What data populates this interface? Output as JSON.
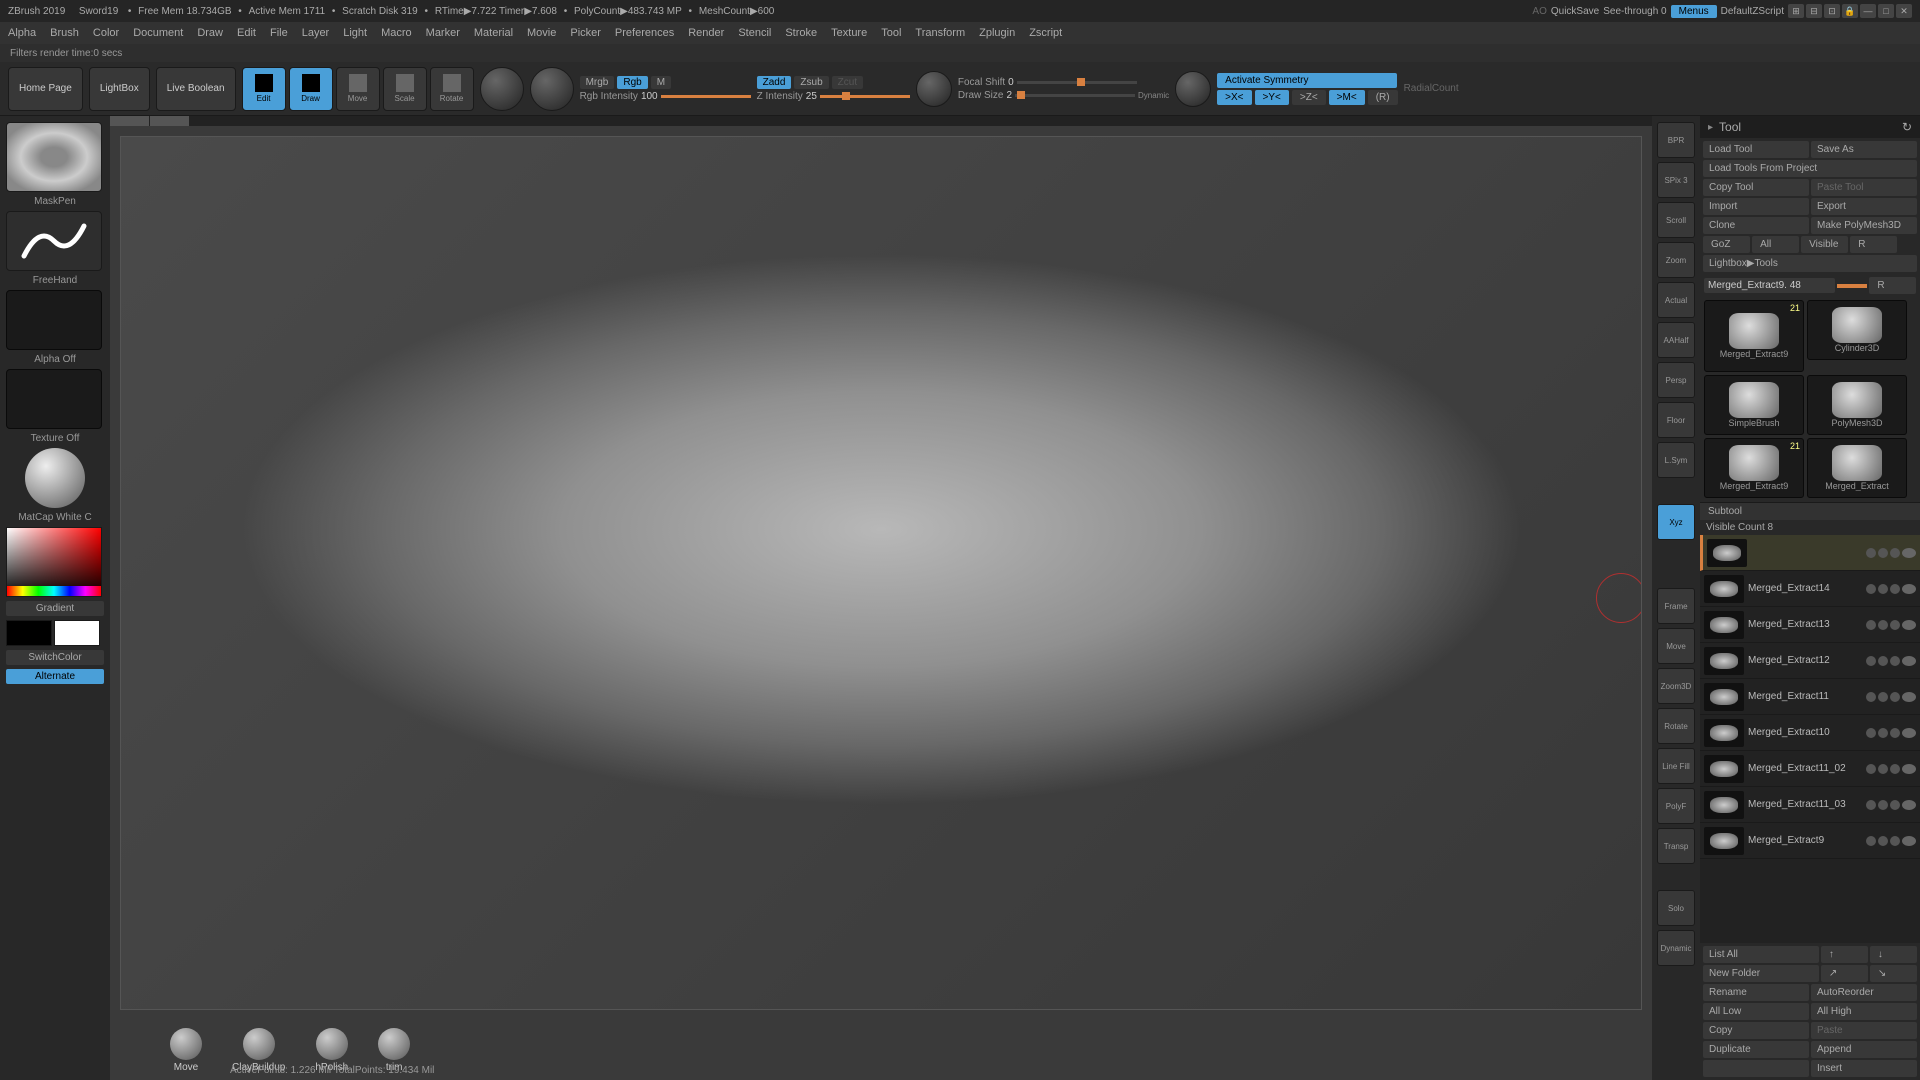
{
  "titlebar": {
    "app": "ZBrush 2019",
    "file": "Sword19",
    "stats": [
      "Free Mem 18.734GB",
      "Active Mem 1711",
      "Scratch Disk 319",
      "RTime▶7.722 Timer▶7.608",
      "PolyCount▶483.743 MP",
      "MeshCount▶600"
    ],
    "ao": "AO",
    "quicksave": "QuickSave",
    "seethrough": "See-through  0",
    "menus": "Menus",
    "script": "DefaultZScript"
  },
  "menus": [
    "Alpha",
    "Brush",
    "Color",
    "Document",
    "Draw",
    "Edit",
    "File",
    "Layer",
    "Light",
    "Macro",
    "Marker",
    "Material",
    "Movie",
    "Picker",
    "Preferences",
    "Render",
    "Stencil",
    "Stroke",
    "Texture",
    "Tool",
    "Transform",
    "Zplugin",
    "Zscript"
  ],
  "status": "Filters render time:0 secs",
  "toolbar": {
    "home": "Home Page",
    "lightbox": "LightBox",
    "liveboolean": "Live Boolean",
    "modes": [
      "Edit",
      "Draw",
      "Move",
      "Scale",
      "Rotate"
    ],
    "mrgb": "Mrgb",
    "rgb": "Rgb",
    "m": "M",
    "rgbint_lbl": "Rgb Intensity",
    "rgbint_val": "100",
    "zadd": "Zadd",
    "zsub": "Zsub",
    "zcut": "Zcut",
    "zint_lbl": "Z Intensity",
    "zint_val": "25",
    "focal_lbl": "Focal Shift",
    "focal_val": "0",
    "draw_lbl": "Draw Size",
    "draw_val": "2",
    "dynamic": "Dynamic",
    "activate_sym": "Activate Symmetry",
    "sx": ">X<",
    "sy": ">Y<",
    "sz": ">Z<",
    "sm": ">M<",
    "sr": "(R)",
    "radial": "RadialCount"
  },
  "left": {
    "brush": "MaskPen",
    "stroke": "FreeHand",
    "alpha": "Alpha Off",
    "texture": "Texture Off",
    "material": "MatCap White C",
    "gradient": "Gradient",
    "switch": "SwitchColor",
    "alternate": "Alternate"
  },
  "viewport_tools": [
    "BPR",
    "SPix 3",
    "Scroll",
    "Zoom",
    "Actual",
    "AAHalf",
    "Persp",
    "Floor",
    "L.Sym",
    "",
    "Xyz",
    "",
    "",
    "Frame",
    "Move",
    "Zoom3D",
    "Rotate",
    "Line Fill",
    "PolyF",
    "Transp",
    "",
    "Solo",
    "Dynamic",
    ""
  ],
  "vp_active": [
    "Xyz"
  ],
  "shelf": [
    {
      "name": "Move"
    },
    {
      "name": "ClayBuildup"
    },
    {
      "name": "hPolish"
    },
    {
      "name": "trim"
    }
  ],
  "stats_line": {
    "active": "ActivePoints: 1.226 Mil",
    "total": "TotalPoints: 19.434 Mil"
  },
  "tool_panel": {
    "title": "Tool",
    "buttons1": [
      {
        "t": "Load Tool"
      },
      {
        "t": "Save As"
      },
      {
        "t": "Load Tools From Project",
        "full": true
      },
      {
        "t": "Copy Tool"
      },
      {
        "t": "Paste Tool",
        "dim": true
      },
      {
        "t": "Import"
      },
      {
        "t": "Export"
      },
      {
        "t": "Clone"
      },
      {
        "t": "Make PolyMesh3D"
      },
      {
        "t": "GoZ",
        "sm": true
      },
      {
        "t": "All",
        "sm": true
      },
      {
        "t": "Visible",
        "sm": true
      },
      {
        "t": "R",
        "sm": true
      },
      {
        "t": "Lightbox▶Tools",
        "full": true
      }
    ],
    "current": "Merged_Extract9. 48",
    "r_btn": "R",
    "thumbs": [
      {
        "label": "Merged_Extract9",
        "badge": "21"
      },
      {
        "label": "Cylinder3D"
      },
      {
        "label": "SimpleBrush"
      },
      {
        "label": "PolyMesh3D"
      },
      {
        "label": "Merged_Extract9",
        "badge": "21"
      },
      {
        "label": "Merged_Extract"
      }
    ]
  },
  "subtool": {
    "header": "Subtool",
    "visible": "Visible Count 8",
    "items": [
      {
        "name": "",
        "sel": true
      },
      {
        "name": "Merged_Extract14"
      },
      {
        "name": "Merged_Extract13"
      },
      {
        "name": "Merged_Extract12"
      },
      {
        "name": "Merged_Extract11"
      },
      {
        "name": "Merged_Extract10"
      },
      {
        "name": "Merged_Extract11_02"
      },
      {
        "name": "Merged_Extract11_03"
      },
      {
        "name": "Merged_Extract9"
      }
    ],
    "footer_btns": [
      {
        "t": "List All"
      },
      {
        "t": "↑",
        "sm": true
      },
      {
        "t": "↓",
        "sm": true
      },
      {
        "t": "New Folder"
      },
      {
        "t": "↗",
        "sm": true
      },
      {
        "t": "↘",
        "sm": true
      },
      {
        "t": "Rename"
      },
      {
        "t": "AutoReorder"
      },
      {
        "t": "All Low"
      },
      {
        "t": "All High"
      },
      {
        "t": "Copy"
      },
      {
        "t": "Paste",
        "dim": true
      },
      {
        "t": "Duplicate"
      },
      {
        "t": "Append"
      },
      {
        "t": "",
        "dim": true
      },
      {
        "t": "Insert"
      }
    ]
  }
}
